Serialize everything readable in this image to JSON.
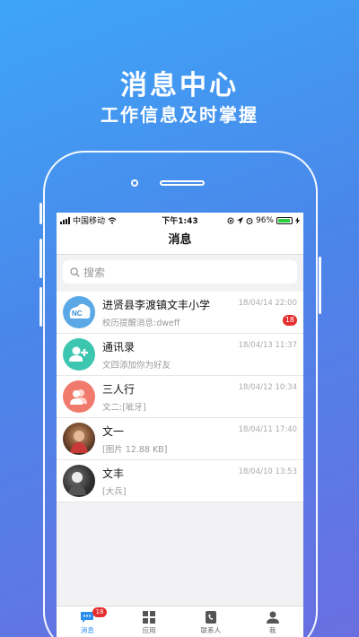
{
  "promo": {
    "title": "消息中心",
    "subtitle": "工作信息及时掌握"
  },
  "status": {
    "carrier": "中国移动",
    "time": "下午1:43",
    "battery": "96%",
    "battery_level": 0.96
  },
  "nav": {
    "title": "消息"
  },
  "search": {
    "placeholder": "搜索"
  },
  "conversations": [
    {
      "name": "进贤县李渡镇文丰小学",
      "preview": "校历提醒消息:dweff",
      "time": "18/04/14 22:00",
      "badge": "18",
      "avatar_text": "NC",
      "avatar_color": "#5aa9e6"
    },
    {
      "name": "通讯录",
      "preview": "文四添加你为好友",
      "time": "18/04/13 11:37",
      "badge": "",
      "avatar_color": "#3cc6b0"
    },
    {
      "name": "三人行",
      "preview": "文二:[呲牙]",
      "time": "18/04/12 10:34",
      "badge": "",
      "avatar_color": "#f07b6c"
    },
    {
      "name": "文一",
      "preview": "[图片 12.88 KB]",
      "time": "18/04/11 17:40",
      "badge": "",
      "avatar_color": "#6b4a3a"
    },
    {
      "name": "文丰",
      "preview": "[大兵]",
      "time": "18/04/10 13:53",
      "badge": "",
      "avatar_color": "#222222"
    }
  ],
  "tabs": [
    {
      "label": "消息",
      "badge": "18"
    },
    {
      "label": "应用"
    },
    {
      "label": "联系人"
    },
    {
      "label": "我"
    }
  ],
  "colors": {
    "accent": "#2b8ff0",
    "badge": "#e52d2d"
  }
}
